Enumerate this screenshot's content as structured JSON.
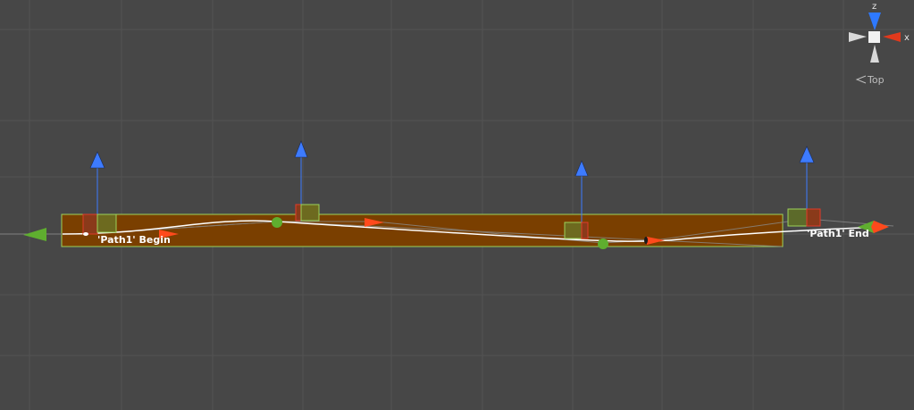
{
  "scene_view": {
    "background_color": "#474747",
    "grid_color": "#535353",
    "path": {
      "begin_label": "'Path1' Begin",
      "end_label": "'Path1' End",
      "bounds_fill": "#7a3f00",
      "bounds_outline": "#9cd35a",
      "curve_color": "#ffffff"
    },
    "handles": {
      "forward_arrow_color": "#ff4a1c",
      "up_arrow_color": "#3d7bff",
      "node_color": "#5fae2f"
    }
  },
  "orientation_gizmo": {
    "axis_z": "z",
    "axis_x": "x",
    "view_label": "Top",
    "view_icon": "perspective-chevron-icon",
    "x_color": "#e0391c",
    "z_color": "#2e79ff",
    "neutral_color": "#d9d9d9"
  }
}
